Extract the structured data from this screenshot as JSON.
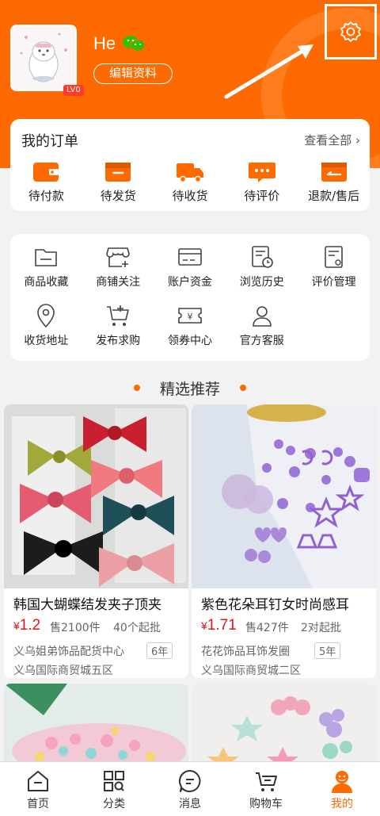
{
  "profile": {
    "username": "He",
    "level": "LV0",
    "edit_label": "编辑资料"
  },
  "orders": {
    "title": "我的订单",
    "view_all": "查看全部",
    "items": [
      {
        "label": "待付款",
        "icon": "wallet-icon"
      },
      {
        "label": "待发货",
        "icon": "package-icon"
      },
      {
        "label": "待收货",
        "icon": "truck-icon"
      },
      {
        "label": "待评价",
        "icon": "comment-icon"
      },
      {
        "label": "退款/售后",
        "icon": "refund-icon"
      }
    ]
  },
  "tools": [
    {
      "label": "商品收藏",
      "icon": "folder-icon"
    },
    {
      "label": "商铺关注",
      "icon": "store-icon"
    },
    {
      "label": "账户资金",
      "icon": "card-icon"
    },
    {
      "label": "浏览历史",
      "icon": "history-icon"
    },
    {
      "label": "评价管理",
      "icon": "review-icon"
    },
    {
      "label": "收货地址",
      "icon": "location-icon"
    },
    {
      "label": "发布求购",
      "icon": "cart-icon"
    },
    {
      "label": "领券中心",
      "icon": "coupon-icon"
    },
    {
      "label": "官方客服",
      "icon": "service-icon"
    }
  ],
  "recommend_title": "精选推荐",
  "products": [
    {
      "name": "韩国大蝴蝶结发夹子顶夹",
      "price_symbol": "¥",
      "price": "1.2",
      "sold": "售2100件",
      "min": "40个起批",
      "shop": "义乌姐弟饰品配货中心",
      "years": "6年",
      "market": "义乌国际商贸城五区"
    },
    {
      "name": "紫色花朵耳钉女时尚感耳",
      "price_symbol": "¥",
      "price": "1.71",
      "sold": "售427件",
      "min": "2对起批",
      "shop": "花花饰品耳饰发圈",
      "years": "5年",
      "market": "义乌国际商贸城二区"
    }
  ],
  "tabs": [
    {
      "label": "首页",
      "icon": "home-icon"
    },
    {
      "label": "分类",
      "icon": "category-icon"
    },
    {
      "label": "消息",
      "icon": "message-icon"
    },
    {
      "label": "购物车",
      "icon": "cart-icon"
    },
    {
      "label": "我的",
      "icon": "profile-icon",
      "active": true
    }
  ],
  "colors": {
    "brand": "#ff6a00",
    "price": "#e4161b"
  }
}
